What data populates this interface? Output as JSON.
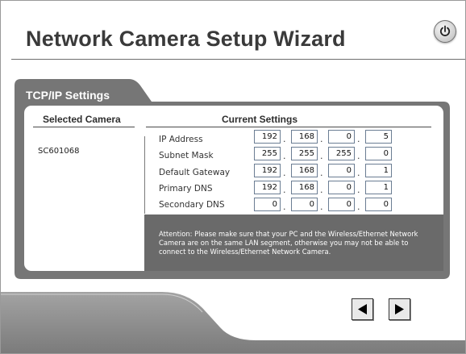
{
  "window": {
    "title": "Network Camera Setup Wizard"
  },
  "panel": {
    "title": "TCP/IP Settings"
  },
  "camera_section": {
    "header": "Selected Camera",
    "camera_name": "SC601068"
  },
  "settings_section": {
    "header": "Current Settings",
    "rows": [
      {
        "label": "IP Address",
        "octets": [
          "192",
          "168",
          "0",
          "5"
        ]
      },
      {
        "label": "Subnet Mask",
        "octets": [
          "255",
          "255",
          "255",
          "0"
        ]
      },
      {
        "label": "Default Gateway",
        "octets": [
          "192",
          "168",
          "0",
          "1"
        ]
      },
      {
        "label": "Primary DNS",
        "octets": [
          "192",
          "168",
          "0",
          "1"
        ]
      },
      {
        "label": "Secondary DNS",
        "octets": [
          "0",
          "0",
          "0",
          "0"
        ]
      }
    ]
  },
  "attention": "Attention: Please make sure that your PC and the Wireless/Ethernet Network Camera are on the same LAN segment, otherwise you may not be able to connect to the Wireless/Ethernet Network Camera.",
  "icons": {
    "power": "power-icon",
    "back": "back-arrow-icon",
    "next": "next-arrow-icon"
  }
}
